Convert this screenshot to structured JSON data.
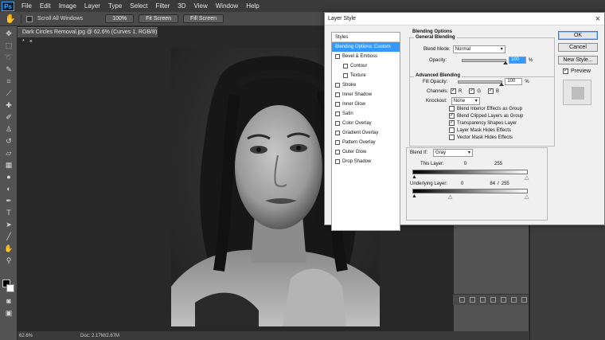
{
  "menubar": {
    "logo": "Ps",
    "items": [
      "File",
      "Edit",
      "Image",
      "Layer",
      "Type",
      "Select",
      "Filter",
      "3D",
      "View",
      "Window",
      "Help"
    ]
  },
  "options_bar": {
    "scroll_all_windows": "Scroll All Windows",
    "btn_100": "100%",
    "btn_fit": "Fit Screen",
    "btn_fill": "Fill Screen"
  },
  "document": {
    "tab_title": "Dark Circles Removal.jpg @ 62.6% (Curves 1, RGB/8) *",
    "close": "×"
  },
  "status": {
    "zoom": "62.6%",
    "doc_size": "Doc: 2.17M/2.67M"
  },
  "dialog": {
    "title": "Layer Style",
    "close": "×",
    "styles_header": "Styles",
    "styles": [
      {
        "label": "Blending Options: Custom",
        "selected": true,
        "checkbox": false,
        "indent": false
      },
      {
        "label": "Bevel & Emboss",
        "selected": false,
        "checkbox": true,
        "indent": false
      },
      {
        "label": "Contour",
        "selected": false,
        "checkbox": true,
        "indent": true
      },
      {
        "label": "Texture",
        "selected": false,
        "checkbox": true,
        "indent": true
      },
      {
        "label": "Stroke",
        "selected": false,
        "checkbox": true,
        "indent": false
      },
      {
        "label": "Inner Shadow",
        "selected": false,
        "checkbox": true,
        "indent": false
      },
      {
        "label": "Inner Glow",
        "selected": false,
        "checkbox": true,
        "indent": false
      },
      {
        "label": "Satin",
        "selected": false,
        "checkbox": true,
        "indent": false
      },
      {
        "label": "Color Overlay",
        "selected": false,
        "checkbox": true,
        "indent": false
      },
      {
        "label": "Gradient Overlay",
        "selected": false,
        "checkbox": true,
        "indent": false
      },
      {
        "label": "Pattern Overlay",
        "selected": false,
        "checkbox": true,
        "indent": false
      },
      {
        "label": "Outer Glow",
        "selected": false,
        "checkbox": true,
        "indent": false
      },
      {
        "label": "Drop Shadow",
        "selected": false,
        "checkbox": true,
        "indent": false
      }
    ],
    "blending_options": "Blending Options",
    "general_blending": "General Blending",
    "blend_mode_label": "Blend Mode:",
    "blend_mode_value": "Normal",
    "opacity_label": "Opacity:",
    "opacity_value": "100",
    "percent": "%",
    "advanced_blending": "Advanced Blending",
    "fill_opacity_label": "Fill Opacity:",
    "fill_opacity_value": "100",
    "channels_label": "Channels:",
    "channel_r": "R",
    "channel_g": "G",
    "channel_b": "B",
    "knockout_label": "Knockout:",
    "knockout_value": "None",
    "advanced_checks": [
      {
        "label": "Blend Interior Effects as Group",
        "checked": false
      },
      {
        "label": "Blend Clipped Layers as Group",
        "checked": true
      },
      {
        "label": "Transparency Shapes Layer",
        "checked": true
      },
      {
        "label": "Layer Mask Hides Effects",
        "checked": false
      },
      {
        "label": "Vector Mask Hides Effects",
        "checked": false
      }
    ],
    "blend_if_label": "Blend If:",
    "blend_if_value": "Gray",
    "this_layer_label": "This Layer:",
    "this_layer_low": "0",
    "this_layer_high": "255",
    "underlying_label": "Underlying Layer:",
    "underlying_low": "0",
    "underlying_mid": "84",
    "underlying_slash": "/",
    "underlying_high": "255",
    "ok": "OK",
    "cancel": "Cancel",
    "new_style": "New Style...",
    "preview": "Preview",
    "check_mark": "✓"
  },
  "colors": {
    "accent": "#3399ff",
    "ps_blue": "#31a8ff"
  },
  "icons": [
    "hand-tool-icon",
    "move-icon",
    "marquee-icon",
    "lasso-icon",
    "quick-select-icon",
    "crop-icon",
    "eyedropper-icon",
    "healing-icon",
    "brush-icon",
    "stamp-icon",
    "history-brush-icon",
    "eraser-icon",
    "gradient-icon",
    "blur-icon",
    "dodge-icon",
    "pen-icon",
    "type-icon",
    "path-select-icon",
    "shape-icon",
    "hand-icon",
    "zoom-icon"
  ]
}
